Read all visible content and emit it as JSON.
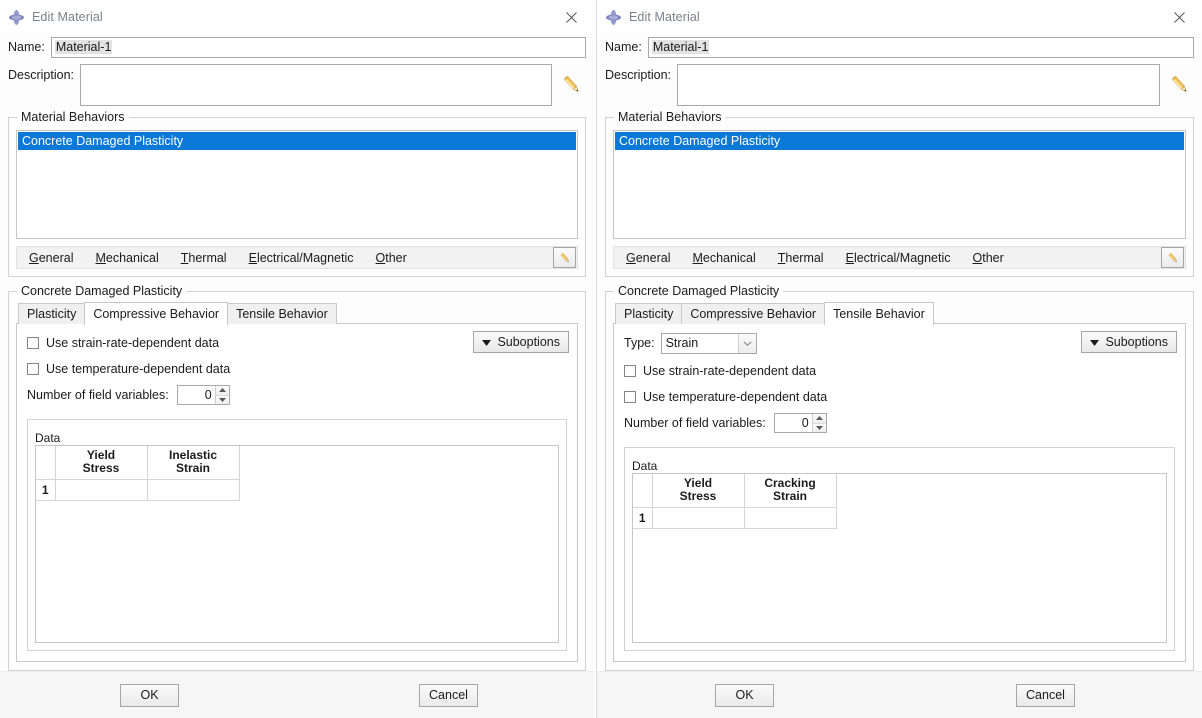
{
  "panels": [
    {
      "id": "left",
      "title": "Edit Material",
      "name_label": "Name:",
      "name_value": "Material-1",
      "description_label": "Description:",
      "description_value": "",
      "behaviors_group_title": "Material Behaviors",
      "behaviors": [
        "Concrete Damaged Plasticity"
      ],
      "menu": [
        {
          "label": "General",
          "mnemonic": "G"
        },
        {
          "label": "Mechanical",
          "mnemonic": "M"
        },
        {
          "label": "Thermal",
          "mnemonic": "T"
        },
        {
          "label": "Electrical/Magnetic",
          "mnemonic": "E"
        },
        {
          "label": "Other",
          "mnemonic": "O"
        }
      ],
      "cdp_group_title": "Concrete Damaged Plasticity",
      "tabs": [
        {
          "label": "Plasticity",
          "active": false
        },
        {
          "label": "Compressive Behavior",
          "active": true
        },
        {
          "label": "Tensile Behavior",
          "active": false
        }
      ],
      "has_type_row": false,
      "type_label": "",
      "type_value": "",
      "strain_rate_label": "Use strain-rate-dependent data",
      "strain_rate_checked": false,
      "temperature_label": "Use temperature-dependent data",
      "temperature_checked": false,
      "field_vars_label": "Number of field variables:",
      "field_vars_value": "0",
      "suboptions_label": "Suboptions",
      "data_group_title": "Data",
      "table": {
        "headers": [
          "",
          "Yield\nStress",
          "Inelastic\nStrain"
        ],
        "header_col_a_line1": "Yield",
        "header_col_a_line2": "Stress",
        "header_col_b_line1": "Inelastic",
        "header_col_b_line2": "Strain",
        "rows": [
          {
            "index": "1",
            "a": "",
            "b": ""
          }
        ]
      },
      "ok_label": "OK",
      "cancel_label": "Cancel"
    },
    {
      "id": "right",
      "title": "Edit Material",
      "name_label": "Name:",
      "name_value": "Material-1",
      "description_label": "Description:",
      "description_value": "",
      "behaviors_group_title": "Material Behaviors",
      "behaviors": [
        "Concrete Damaged Plasticity"
      ],
      "menu": [
        {
          "label": "General",
          "mnemonic": "G"
        },
        {
          "label": "Mechanical",
          "mnemonic": "M"
        },
        {
          "label": "Thermal",
          "mnemonic": "T"
        },
        {
          "label": "Electrical/Magnetic",
          "mnemonic": "E"
        },
        {
          "label": "Other",
          "mnemonic": "O"
        }
      ],
      "cdp_group_title": "Concrete Damaged Plasticity",
      "tabs": [
        {
          "label": "Plasticity",
          "active": false
        },
        {
          "label": "Compressive Behavior",
          "active": false
        },
        {
          "label": "Tensile Behavior",
          "active": true
        }
      ],
      "has_type_row": true,
      "type_label": "Type:",
      "type_value": "Strain",
      "strain_rate_label": "Use strain-rate-dependent data",
      "strain_rate_checked": false,
      "temperature_label": "Use temperature-dependent data",
      "temperature_checked": false,
      "field_vars_label": "Number of field variables:",
      "field_vars_value": "0",
      "suboptions_label": "Suboptions",
      "data_group_title": "Data",
      "table": {
        "headers": [
          "",
          "Yield\nStress",
          "Cracking\nStrain"
        ],
        "header_col_a_line1": "Yield",
        "header_col_a_line2": "Stress",
        "header_col_b_line1": "Cracking",
        "header_col_b_line2": "Strain",
        "rows": [
          {
            "index": "1",
            "a": "",
            "b": ""
          }
        ]
      },
      "ok_label": "OK",
      "cancel_label": "Cancel"
    }
  ],
  "icons": {
    "title": "material-diamond-icon",
    "close": "close-icon",
    "pencil": "pencil-icon",
    "dropdown": "chevron-down-icon"
  },
  "colors": {
    "selection": "#0a78d7",
    "title_text": "#7b7f8a",
    "icon_purple": "#8a8ec4",
    "pencil_body": "#f0c159"
  }
}
